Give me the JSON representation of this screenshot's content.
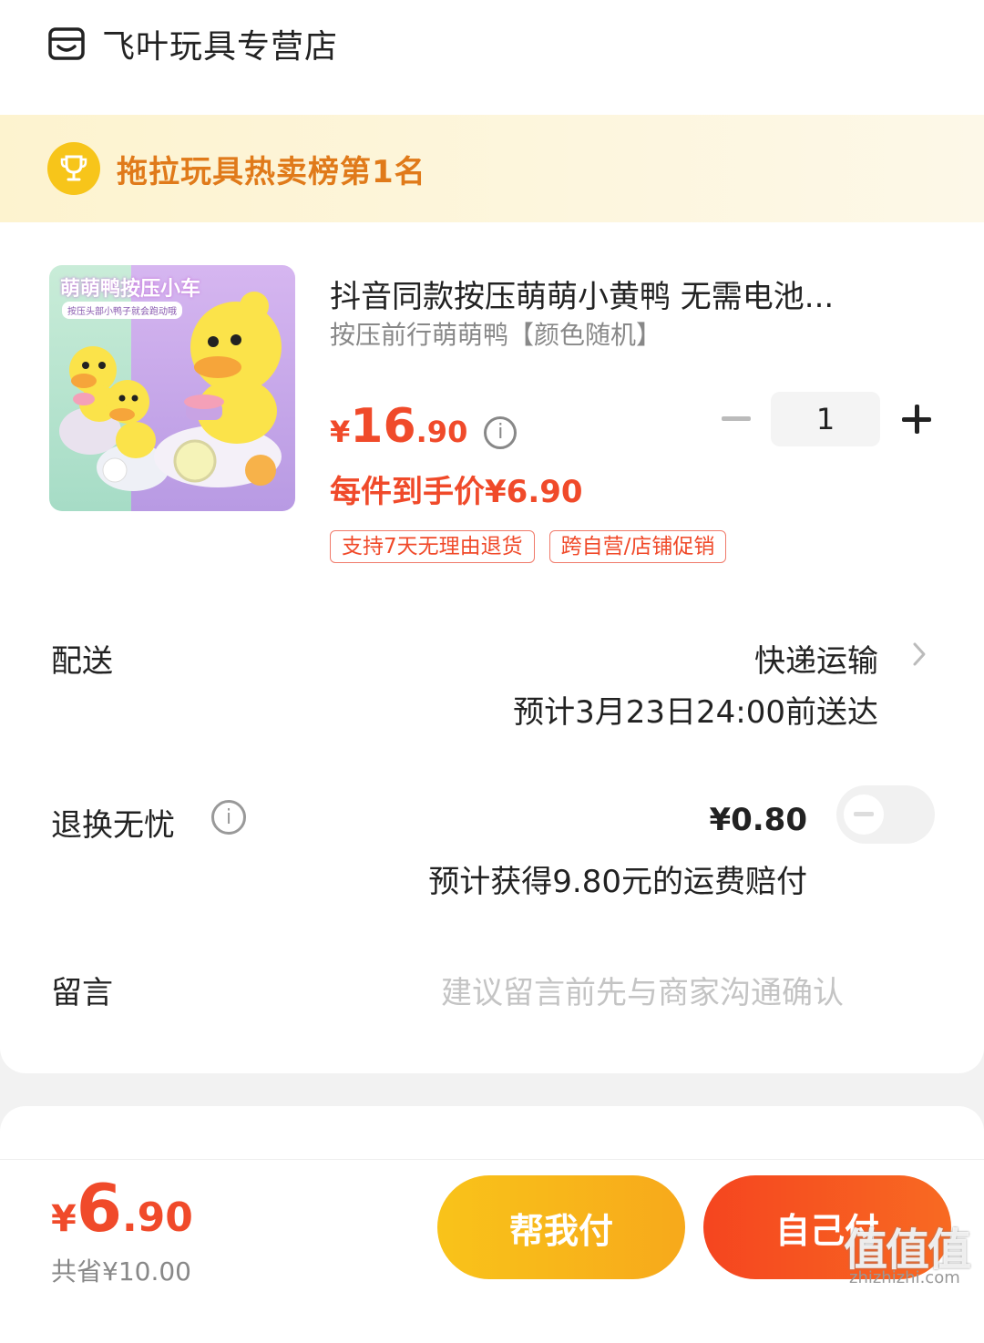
{
  "store": {
    "name": "飞叶玩具专营店",
    "icon": "store-icon"
  },
  "rank_banner": {
    "text": "拖拉玩具热卖榜第1名",
    "icon": "trophy-icon"
  },
  "product": {
    "image_caption": "萌萌鸭按压小车",
    "image_subcaption": "按压头部小鸭子就会跑动哦",
    "title": "抖音同款按压萌萌小黄鸭 无需电池...",
    "variant": "按压前行萌萌鸭【颜色随机】",
    "price_symbol": "¥",
    "price_int": "16",
    "price_dec": ".90",
    "final_price": "每件到手价¥6.90",
    "quantity": "1",
    "tags": [
      "支持7天无理由退货",
      "跨自营/店铺促销"
    ]
  },
  "delivery": {
    "label": "配送",
    "method": "快递运输",
    "eta": "预计3月23日24:00前送达"
  },
  "return_insurance": {
    "label": "退换无忧",
    "price": "¥0.80",
    "note": "预计获得9.80元的运费赔付",
    "enabled": false
  },
  "message": {
    "label": "留言",
    "placeholder": "建议留言前先与商家沟通确认"
  },
  "footer": {
    "total_symbol": "¥",
    "total_int": "6",
    "total_dec": ".90",
    "saved": "共省¥10.00",
    "help_pay_label": "帮我付",
    "self_pay_label": "自己付"
  },
  "watermark": {
    "text": "值值值",
    "url": "zhizhizhi.com"
  },
  "colors": {
    "accent": "#f04a2a",
    "gold": "#f7c51a",
    "banner_text": "#e07a1a"
  }
}
